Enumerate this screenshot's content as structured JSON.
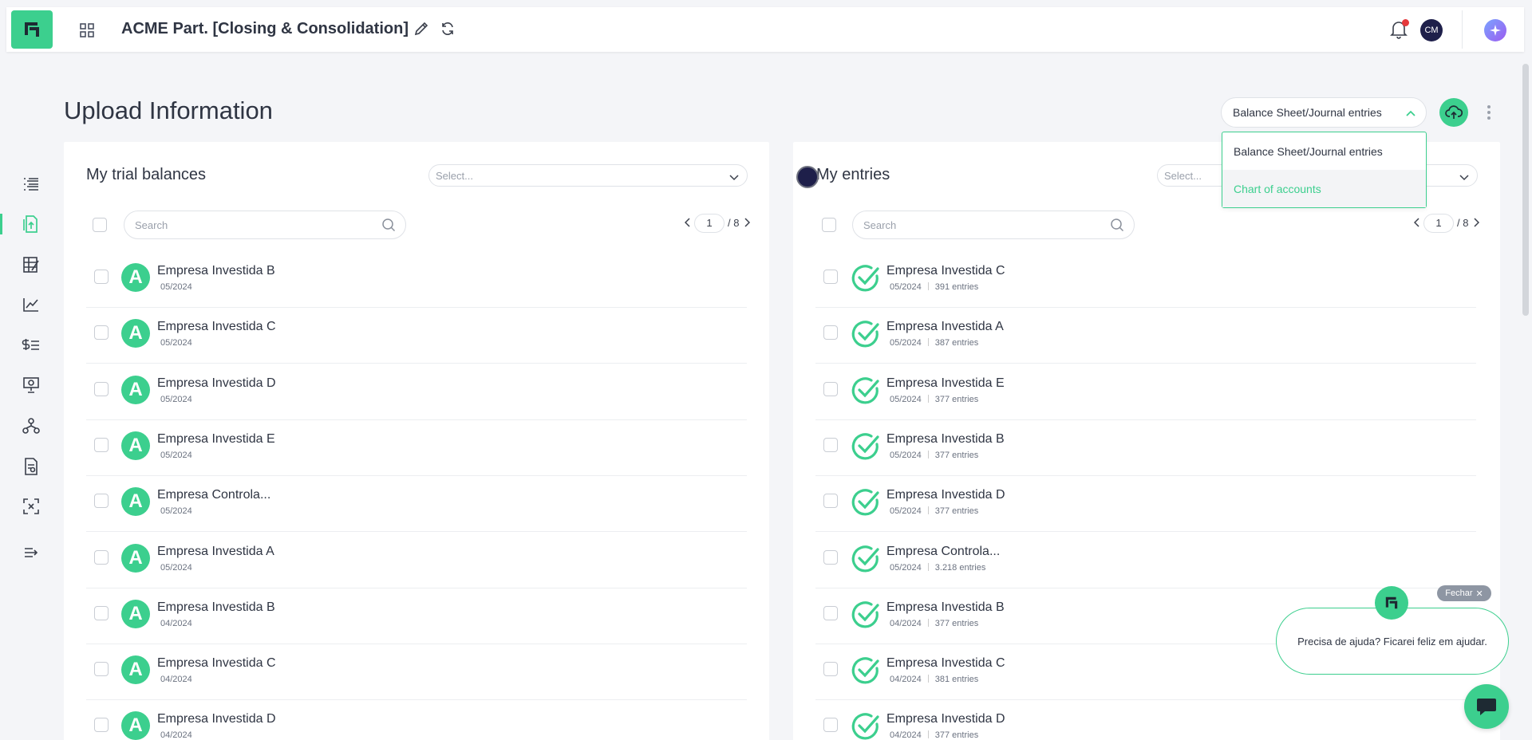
{
  "header": {
    "title": "ACME Part. [Closing & Consolidation]",
    "avatar_initials": "CM"
  },
  "page": {
    "title": "Upload Information",
    "type_select_value": "Balance Sheet/Journal entries",
    "dropdown_options": [
      "Balance Sheet/Journal entries",
      "Chart of accounts"
    ]
  },
  "left_card": {
    "title": "My trial balances",
    "select_placeholder": "Select...",
    "search_placeholder": "Search",
    "page_current": "1",
    "page_total": "/ 8",
    "rows": [
      {
        "name": "Empresa Investida B",
        "period": "05/2024"
      },
      {
        "name": "Empresa Investida C",
        "period": "05/2024"
      },
      {
        "name": "Empresa Investida D",
        "period": "05/2024"
      },
      {
        "name": "Empresa Investida E",
        "period": "05/2024"
      },
      {
        "name": "Empresa Controla...",
        "period": "05/2024"
      },
      {
        "name": "Empresa Investida A",
        "period": "05/2024"
      },
      {
        "name": "Empresa Investida B",
        "period": "04/2024"
      },
      {
        "name": "Empresa Investida C",
        "period": "04/2024"
      },
      {
        "name": "Empresa Investida D",
        "period": "04/2024"
      }
    ],
    "badge_letter": "A"
  },
  "right_card": {
    "title": "My entries",
    "select_placeholder": "Select...",
    "search_placeholder": "Search",
    "page_current": "1",
    "page_total": "/ 8",
    "rows": [
      {
        "name": "Empresa Investida C",
        "period": "05/2024",
        "entries": "391 entries"
      },
      {
        "name": "Empresa Investida A",
        "period": "05/2024",
        "entries": "387 entries"
      },
      {
        "name": "Empresa Investida E",
        "period": "05/2024",
        "entries": "377 entries"
      },
      {
        "name": "Empresa Investida B",
        "period": "05/2024",
        "entries": "377 entries"
      },
      {
        "name": "Empresa Investida D",
        "period": "05/2024",
        "entries": "377 entries"
      },
      {
        "name": "Empresa Controla...",
        "period": "05/2024",
        "entries": "3.218 entries"
      },
      {
        "name": "Empresa Investida B",
        "period": "04/2024",
        "entries": "377 entries"
      },
      {
        "name": "Empresa Investida C",
        "period": "04/2024",
        "entries": "381 entries"
      },
      {
        "name": "Empresa Investida D",
        "period": "04/2024",
        "entries": "377 entries"
      }
    ]
  },
  "help": {
    "close_label": "Fechar",
    "message": "Precisa de ajuda? Ficarei feliz em ajudar."
  },
  "colors": {
    "accent": "#3ccf8e",
    "dark": "#1e1f4a",
    "notification": "#e5383b"
  },
  "icons": {
    "sidebar": [
      "list-icon",
      "upload-file-icon",
      "edit-table-icon",
      "line-chart-icon",
      "dollar-list-icon",
      "presentation-icon",
      "hierarchy-icon",
      "report-icon",
      "expand-icon",
      "collapse-menu-icon"
    ]
  }
}
